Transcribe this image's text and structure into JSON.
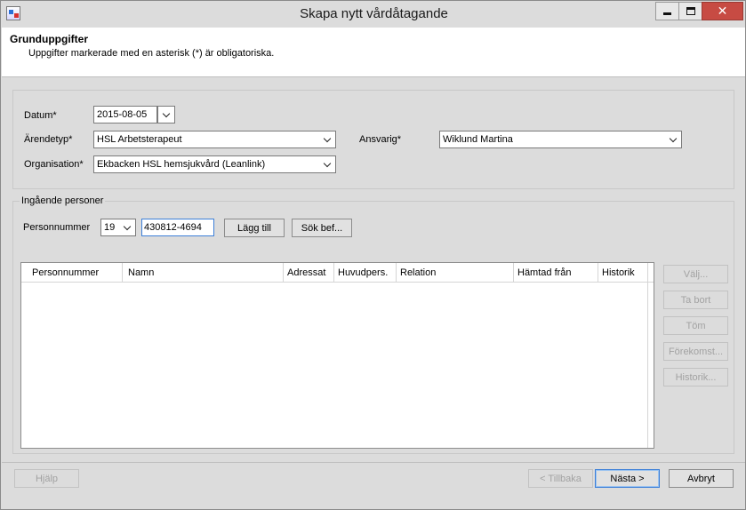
{
  "window": {
    "title": "Skapa nytt vårdåtagande",
    "minimize_label": "",
    "maximize_label": "",
    "close_label": "✕"
  },
  "header": {
    "title": "Grunduppgifter",
    "subtitle": "Uppgifter markerade med en asterisk (*) är obligatoriska."
  },
  "form": {
    "datum_label": "Datum*",
    "datum_value": "2015-08-05",
    "arendetyp_label": "Ärendetyp*",
    "arendetyp_value": "HSL Arbetsterapeut",
    "ansvarig_label": "Ansvarig*",
    "ansvarig_value": "Wiklund Martina",
    "organisation_label": "Organisation*",
    "organisation_value": "Ekbacken HSL hemsjukvård (Leanlink)"
  },
  "persons": {
    "group_label": "Ingående personer",
    "personnummer_label": "Personnummer",
    "century_value": "19",
    "personnummer_value": "430812-4694",
    "add_button": "Lägg till",
    "search_button": "Sök bef...",
    "columns": [
      "Personnummer",
      "Namn",
      "Adressat",
      "Huvudpers.",
      "Relation",
      "Hämtad från",
      "Historik"
    ],
    "side_buttons": [
      "Välj...",
      "Ta bort",
      "Töm",
      "Förekomst...",
      "Historik..."
    ]
  },
  "footer": {
    "help_button": "Hjälp",
    "back_button": "< Tillbaka",
    "next_button": "Nästa >",
    "cancel_button": "Avbryt"
  }
}
